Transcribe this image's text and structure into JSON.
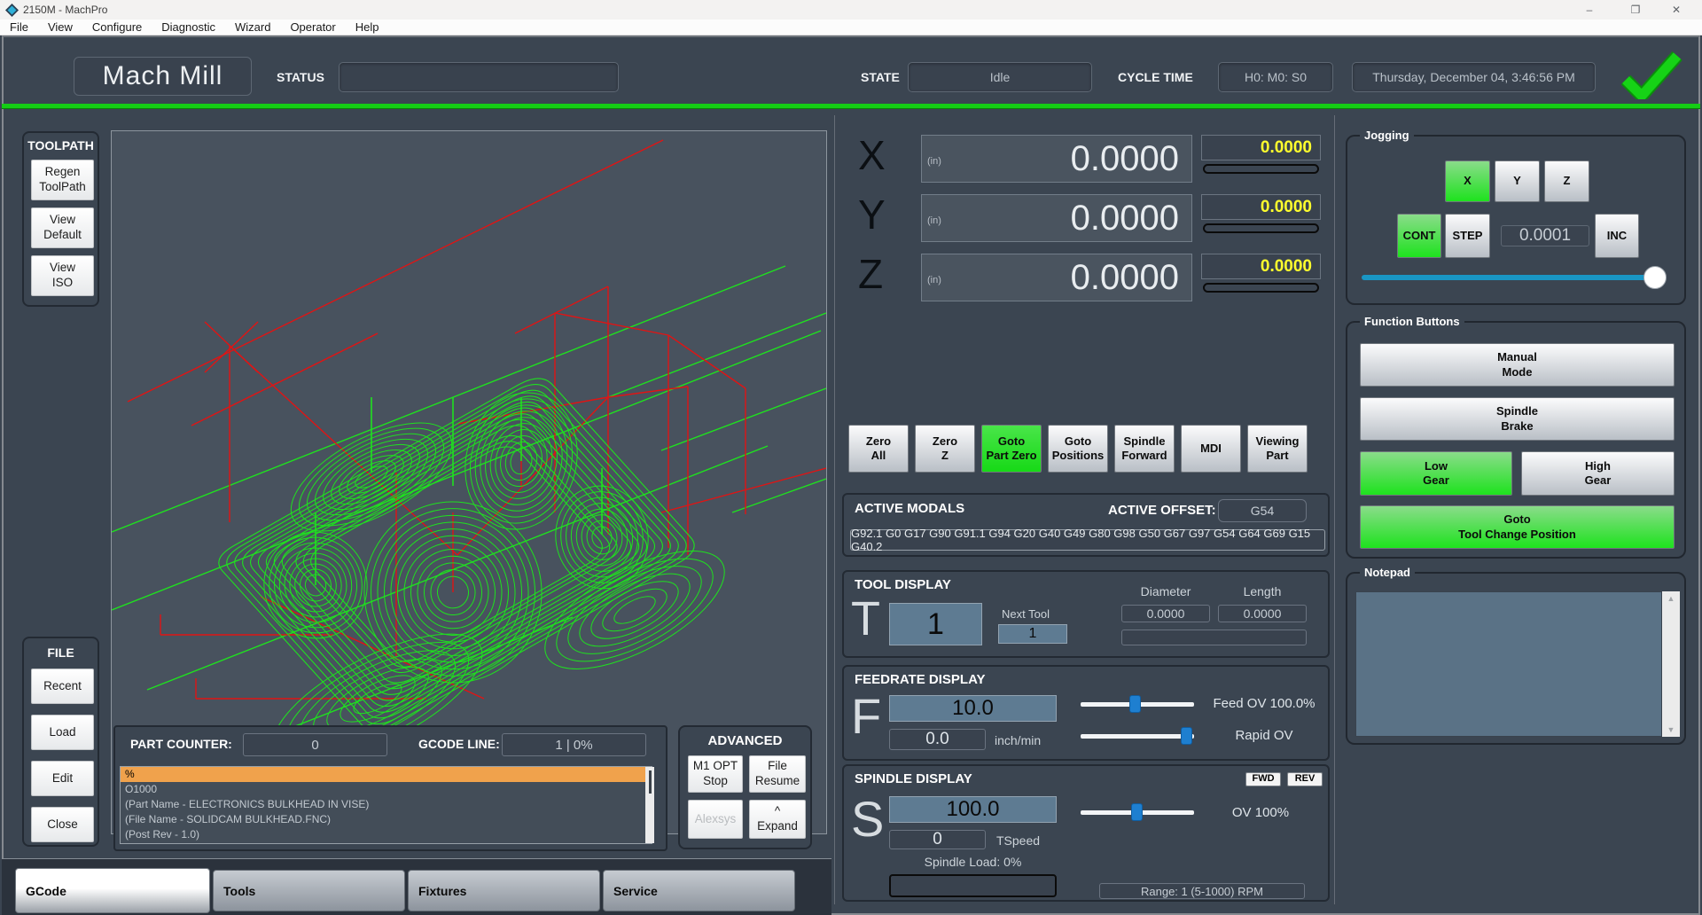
{
  "window": {
    "title": "2150M - MachPro",
    "minimize": "–",
    "maximize": "❐",
    "close": "✕"
  },
  "menu": {
    "items": [
      "File",
      "View",
      "Configure",
      "Diagnostic",
      "Wizard",
      "Operator",
      "Help"
    ]
  },
  "header": {
    "logo": "Mach Mill",
    "status_label": "STATUS",
    "status_value": "",
    "state_label": "STATE",
    "state_value": "Idle",
    "cycle_label": "CYCLE TIME",
    "cycle_value": "H0: M0: S0",
    "datetime": "Thursday, December 04, 3:46:56 PM"
  },
  "toolpath": {
    "title": "TOOLPATH",
    "regen": "Regen\nToolPath",
    "view_default": "View\nDefault",
    "view_iso": "View\nISO"
  },
  "file": {
    "title": "FILE",
    "recent": "Recent",
    "load": "Load",
    "edit": "Edit",
    "close": "Close"
  },
  "gstatus": {
    "part_counter_label": "PART COUNTER:",
    "part_counter": "0",
    "gcode_line_label": "GCODE LINE:",
    "gcode_line": "1 | 0%",
    "lines": [
      "%",
      "O1000",
      "(Part Name - ELECTRONICS BULKHEAD IN VISE)",
      "(File Name - SOLIDCAM BULKHEAD.FNC)",
      "(Post Rev - 1.0)"
    ]
  },
  "advanced": {
    "title": "ADVANCED",
    "m1": "M1 OPT\nStop",
    "resume": "File\nResume",
    "alexsys": "Alexsys",
    "expand": "^\nExpand"
  },
  "tabs": {
    "gcode": "GCode",
    "tools": "Tools",
    "fixtures": "Fixtures",
    "service": "Service"
  },
  "dro": {
    "x": {
      "axis": "X",
      "unit": "(in)",
      "value": "0.0000",
      "dtg": "0.0000"
    },
    "y": {
      "axis": "Y",
      "unit": "(in)",
      "value": "0.0000",
      "dtg": "0.0000"
    },
    "z": {
      "axis": "Z",
      "unit": "(in)",
      "value": "0.0000",
      "dtg": "0.0000"
    }
  },
  "actions": {
    "zero_all": "Zero\nAll",
    "zero_z": "Zero\nZ",
    "goto_part_zero": "Goto\nPart Zero",
    "goto_positions": "Goto\nPositions",
    "spindle_forward": "Spindle\nForward",
    "mdi": "MDI",
    "viewing_part": "Viewing\nPart"
  },
  "modals": {
    "title": "ACTIVE MODALS",
    "offset_label": "ACTIVE OFFSET:",
    "offset": "G54",
    "codes": "G92.1 G0 G17 G90 G91.1 G94 G20 G40 G49 G80 G98 G50 G67 G97 G54 G64 G69 G15 G40.2"
  },
  "tool": {
    "title": "TOOL DISPLAY",
    "t": "T",
    "current": "1",
    "next_label": "Next Tool",
    "next": "1",
    "diameter_label": "Diameter",
    "diameter": "0.0000",
    "length_label": "Length",
    "length": "0.0000"
  },
  "feed": {
    "title": "FEEDRATE DISPLAY",
    "f": "F",
    "programmed": "10.0",
    "actual": "0.0",
    "units": "inch/min",
    "feed_ov": "Feed OV 100.0%",
    "rapid_ov": "Rapid OV"
  },
  "spindle": {
    "title": "SPINDLE DISPLAY",
    "s": "S",
    "fwd": "FWD",
    "rev": "REV",
    "programmed": "100.0",
    "actual": "0",
    "tspeed": "TSpeed",
    "ov": "OV 100%",
    "load": "Spindle Load: 0%",
    "range": "Range: 1 (5-1000) RPM"
  },
  "jog": {
    "title": "Jogging",
    "x": "X",
    "y": "Y",
    "z": "Z",
    "cont": "CONT",
    "step": "STEP",
    "increment": "0.0001",
    "inc": "INC"
  },
  "functions": {
    "title": "Function Buttons",
    "manual": "Manual\nMode",
    "brake": "Spindle\nBrake",
    "low": "Low\nGear",
    "high": "High\nGear",
    "goto_tc": "Goto\nTool Change Position"
  },
  "notepad": {
    "title": "Notepad",
    "content": ""
  },
  "colors": {
    "green_path": "#1fe11f",
    "red_path": "#e01414",
    "accent_green": "#15cd15"
  }
}
